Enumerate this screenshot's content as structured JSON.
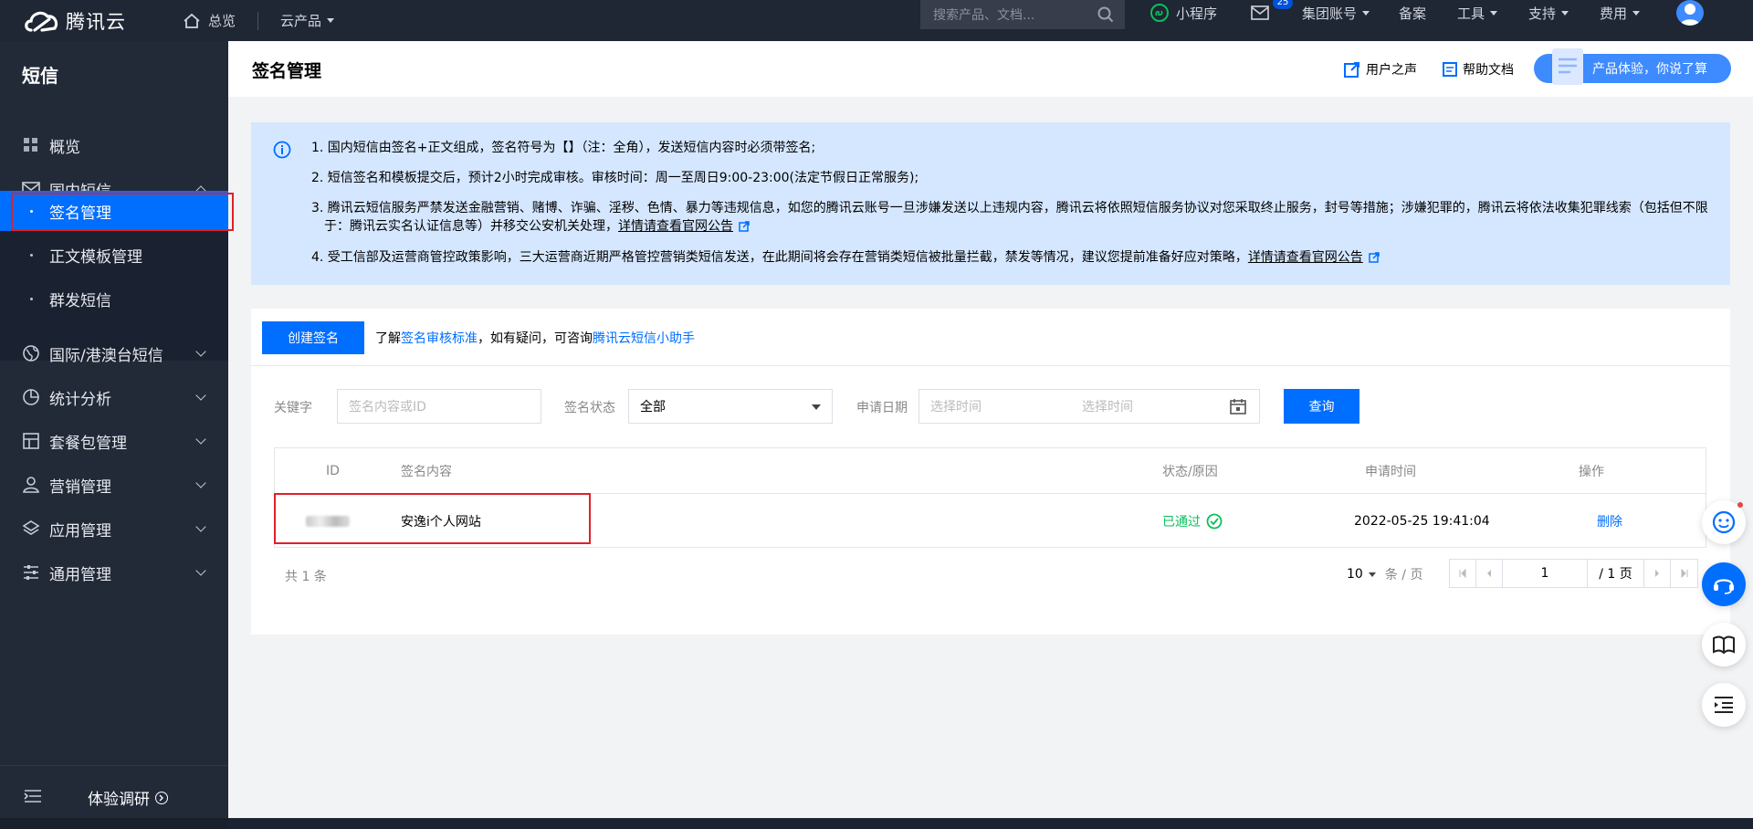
{
  "topbar": {
    "brand": "腾讯云",
    "home": "总览",
    "products": "云产品",
    "search_placeholder": "搜索产品、文档...",
    "mini_program": "小程序",
    "mail_badge": "25",
    "group_account": "集团账号",
    "record": "备案",
    "tools": "工具",
    "support": "支持",
    "billing": "费用"
  },
  "sidebar": {
    "title": "短信",
    "overview": "概览",
    "domestic": "国内短信",
    "signature": "签名管理",
    "template": "正文模板管理",
    "bulk": "群发短信",
    "international": "国际/港澳台短信",
    "stats": "统计分析",
    "package": "套餐包管理",
    "marketing": "营销管理",
    "app": "应用管理",
    "general": "通用管理",
    "survey": "体验调研"
  },
  "header": {
    "title": "签名管理",
    "user_voice": "用户之声",
    "help_doc": "帮助文档",
    "feedback": "产品体验，你说了算"
  },
  "notice": {
    "line1": "1. 国内短信由签名+正文组成，签名符号为【】（注：全角），发送短信内容时必须带签名;",
    "line2": "2. 短信签名和模板提交后，预计2小时完成审核。审核时间：周一至周日9:00-23:00(法定节假日正常服务);",
    "line3": "3. 腾讯云短信服务严禁发送金融营销、赌博、诈骗、淫秽、色情、暴力等违规信息，如您的腾讯云账号一旦涉嫌发送以上违规内容，腾讯云将依照短信服务协议对您采取终止服务，封号等措施；涉嫌犯罪的，腾讯云将依法收集犯罪线索（包括但不限于：腾讯云实名认证信息等）并移交公安机关处理，",
    "line3_link": "详情请查看官网公告",
    "line4": "4. 受工信部及运营商管控政策影响，三大运营商近期严格管控营销类短信发送，在此期间将会存在营销类短信被批量拦截，禁发等情况，建议您提前准备好应对策略，",
    "line4_link": "详情请查看官网公告"
  },
  "toolbar": {
    "create": "创建签名",
    "tip_prefix": "了解",
    "tip_link1": "签名审核标准",
    "tip_middle": "，如有疑问，可咨询",
    "tip_link2": "腾讯云短信小助手"
  },
  "filters": {
    "keyword_label": "关键字",
    "keyword_placeholder": "签名内容或ID",
    "status_label": "签名状态",
    "status_value": "全部",
    "date_label": "申请日期",
    "date_start": "选择时间",
    "date_end": "选择时间",
    "query": "查询"
  },
  "table": {
    "headers": [
      "ID",
      "签名内容",
      "状态/原因",
      "申请时间",
      "操作"
    ],
    "rows": [
      {
        "content": "安逸i个人网站",
        "status": "已通过",
        "time": "2022-05-25 19:41:04",
        "action": "删除"
      }
    ]
  },
  "pagination": {
    "total": "共 1 条",
    "page_size": "10",
    "page_size_unit": "条 / 页",
    "current": "1",
    "total_pages": "/ 1 页"
  },
  "colors": {
    "primary": "#006eff",
    "success": "#0abf5b",
    "sidebar": "#222a38",
    "topbar": "#1f2634",
    "notice_bg": "#d5e7ff",
    "highlight": "#e0202a"
  }
}
